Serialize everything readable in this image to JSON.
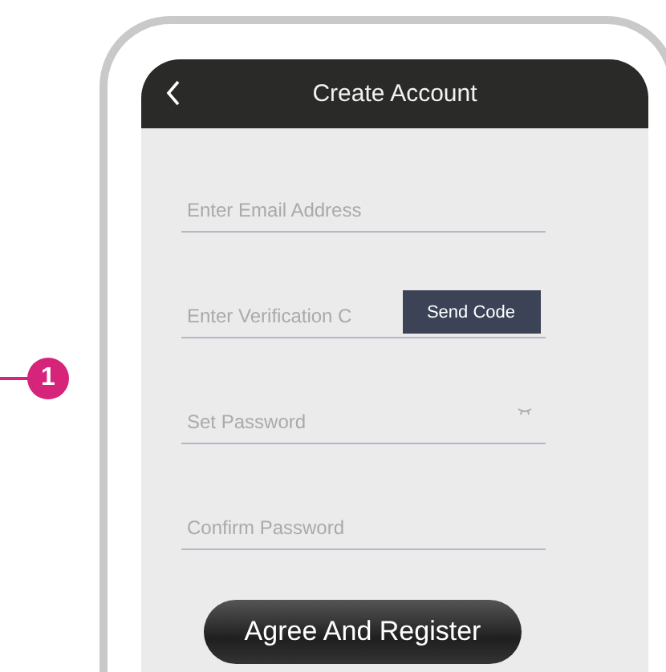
{
  "callout": {
    "label": "1"
  },
  "header": {
    "title": "Create Account"
  },
  "fields": [
    {
      "kind": "text",
      "placeholder": "Enter Email Address"
    },
    {
      "kind": "code",
      "placeholder": "Enter Verification C",
      "button": "Send Code"
    },
    {
      "kind": "password",
      "placeholder": "Set Password"
    },
    {
      "kind": "text",
      "placeholder": "Confirm Password"
    }
  ],
  "submit": {
    "label": "Agree And Register"
  }
}
